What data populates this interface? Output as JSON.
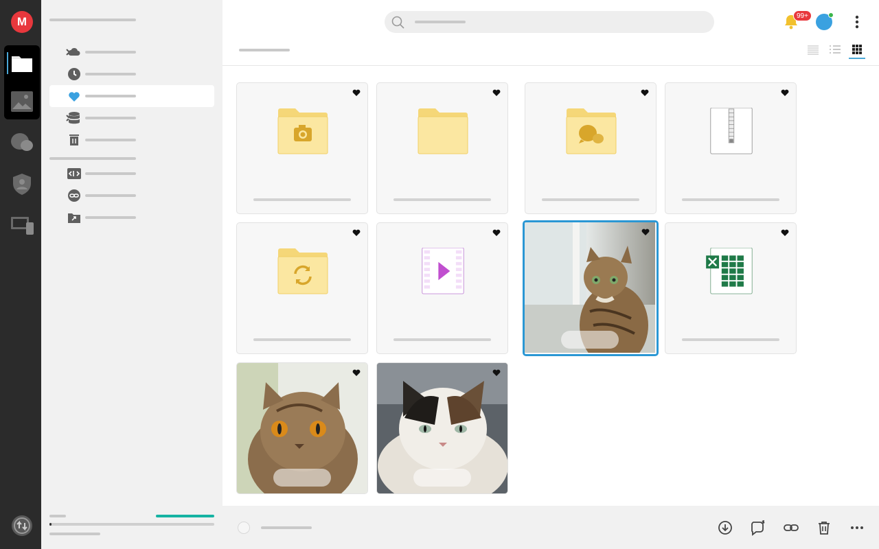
{
  "app": {
    "logo_letter": "M",
    "brand_color": "#e8383d",
    "accent_color": "#2a97d4"
  },
  "rail": {
    "items": [
      {
        "icon": "files-icon",
        "active": true
      },
      {
        "icon": "photos-icon",
        "active": false
      },
      {
        "icon": "chat-icon",
        "active": false
      },
      {
        "icon": "security-shield-icon",
        "active": false
      },
      {
        "icon": "devices-icon",
        "active": false
      }
    ],
    "bottom_icon": "sync-icon"
  },
  "sidebar": {
    "items": [
      {
        "icon": "cloud-icon",
        "expandable": true,
        "active": false
      },
      {
        "icon": "clock-icon",
        "expandable": false,
        "active": false
      },
      {
        "icon": "heart-icon",
        "expandable": false,
        "active": true
      },
      {
        "icon": "database-icon",
        "expandable": true,
        "active": false
      },
      {
        "icon": "trash-icon",
        "expandable": false,
        "active": false
      },
      {
        "icon": "code-icon",
        "expandable": false,
        "active": false
      },
      {
        "icon": "link-icon",
        "expandable": false,
        "active": false
      },
      {
        "icon": "shared-folder-icon",
        "expandable": false,
        "active": false
      }
    ],
    "storage_usage_fraction": 0.01,
    "storage_bar_color": "#16b3a3"
  },
  "header": {
    "search_icon": "search-icon",
    "notification_badge": "99+",
    "avatar_color": "#3aa1e0",
    "view_modes": [
      "list-compact-icon",
      "list-detail-icon",
      "grid-icon"
    ],
    "active_view": "grid-icon"
  },
  "files": [
    {
      "kind": "folder-camera",
      "icon": "camera-folder-icon",
      "selected": false,
      "favorite": true
    },
    {
      "kind": "folder",
      "icon": "folder-icon",
      "selected": false,
      "favorite": true
    },
    {
      "kind": "folder-chat",
      "icon": "chat-folder-icon",
      "selected": false,
      "favorite": true
    },
    {
      "kind": "archive",
      "icon": "zip-file-icon",
      "selected": false,
      "favorite": true
    },
    {
      "kind": "folder-sync",
      "icon": "sync-folder-icon",
      "selected": false,
      "favorite": true
    },
    {
      "kind": "video",
      "icon": "video-file-icon",
      "selected": false,
      "favorite": true
    },
    {
      "kind": "image",
      "icon": "cat-photo-thumbnail",
      "selected": true,
      "favorite": true
    },
    {
      "kind": "spreadsheet",
      "icon": "excel-file-icon",
      "selected": false,
      "favorite": true
    },
    {
      "kind": "image",
      "icon": "cat-photo-thumbnail",
      "selected": false,
      "favorite": true
    },
    {
      "kind": "image",
      "icon": "cat-photo-thumbnail",
      "selected": false,
      "favorite": true
    }
  ],
  "footer": {
    "actions": [
      "download-icon",
      "share-icon",
      "link-icon",
      "trash-icon",
      "more-icon"
    ]
  }
}
